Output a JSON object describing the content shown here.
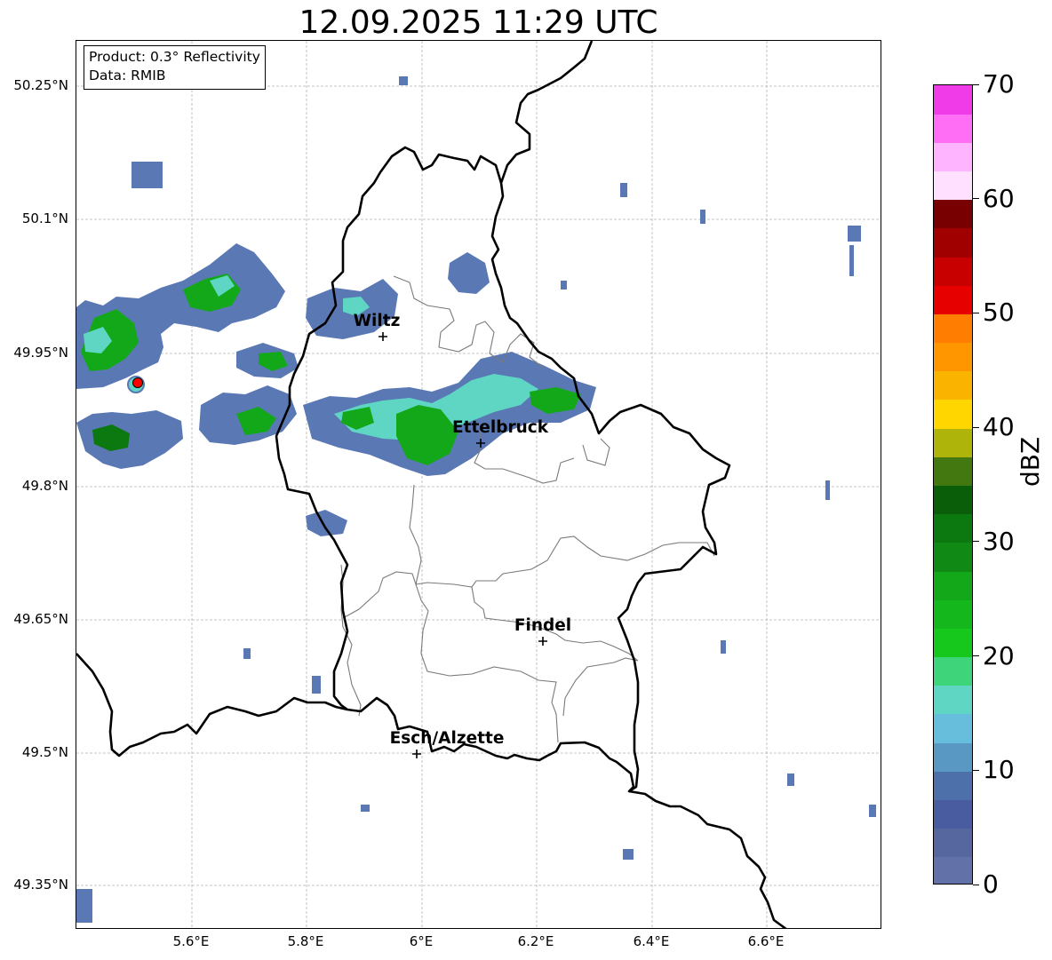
{
  "title": "12.09.2025 11:29 UTC",
  "info_box": {
    "product": "Product: 0.3° Reflectivity",
    "data": "Data: RMIB"
  },
  "lat_labels": [
    "50.25°N",
    "50.1°N",
    "49.95°N",
    "49.8°N",
    "49.65°N",
    "49.5°N",
    "49.35°N"
  ],
  "lon_labels": [
    "5.6°E",
    "5.8°E",
    "6°E",
    "6.2°E",
    "6.4°E",
    "6.6°E"
  ],
  "cities": [
    {
      "name": "Wiltz"
    },
    {
      "name": "Ettelbruck"
    },
    {
      "name": "Findel"
    },
    {
      "name": "Esch/Alzette"
    }
  ],
  "colorbar": {
    "unit": "dBZ",
    "min": 0,
    "max": 70,
    "tick_labels": [
      "0",
      "10",
      "20",
      "30",
      "40",
      "50",
      "60",
      "70"
    ],
    "colors": [
      "#6272a8",
      "#56669e",
      "#4a5ca0",
      "#4e70aa",
      "#5a98c4",
      "#66bedc",
      "#5fd6c4",
      "#3ed47a",
      "#16c81c",
      "#14b81c",
      "#12a81a",
      "#108a14",
      "#0c7810",
      "#0a5e0a",
      "#437810",
      "#afb40a",
      "#ffd600",
      "#fab400",
      "#ff9600",
      "#ff7d00",
      "#e60000",
      "#c80000",
      "#a00000",
      "#780000",
      "#ffe1ff",
      "#ffb4ff",
      "#ff6ef4",
      "#ef3ce8"
    ]
  },
  "radar_site_color": "#ff0000"
}
